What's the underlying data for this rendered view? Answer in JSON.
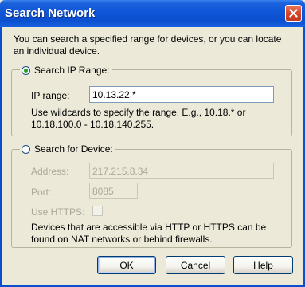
{
  "window": {
    "title": "Search Network",
    "intro_line1": "You can search a specified range for devices, or you can locate",
    "intro_line2": "an individual device."
  },
  "ip_range_group": {
    "radio_label": "Search IP Range:",
    "selected": true,
    "ip_range_label": "IP range:",
    "ip_range_value": "10.13.22.*",
    "hint_line1": "Use wildcards to specify the range. E.g., 10.18.* or",
    "hint_line2": "10.18.100.0 - 10.18.140.255."
  },
  "device_group": {
    "radio_label": "Search for Device:",
    "selected": false,
    "address_label": "Address:",
    "address_value": "217.215.8.34",
    "port_label": "Port:",
    "port_value": "8085",
    "use_https_label": "Use HTTPS:",
    "note_line1": "Devices that are accessible via HTTP or HTTPS can be",
    "note_line2": "found on NAT networks or behind firewalls."
  },
  "buttons": {
    "ok": "OK",
    "cancel": "Cancel",
    "help": "Help"
  },
  "colors": {
    "title_bar": "#0b4fcf",
    "dialog_bg": "#ece9d8",
    "close_button": "#d6452a",
    "selected_radio": "#21a121"
  }
}
